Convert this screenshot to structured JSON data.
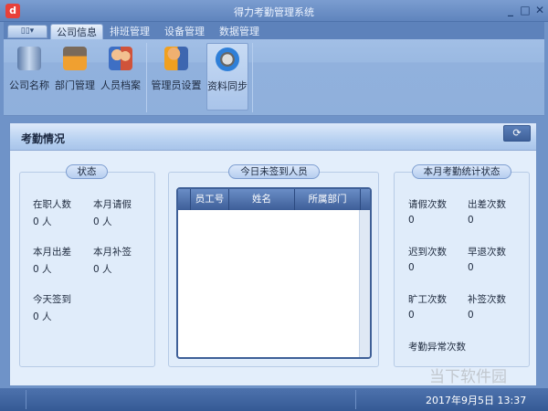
{
  "window": {
    "title": "得力考勤管理系统",
    "logo": "d",
    "controls": [
      "minimize-icon",
      "maximize-icon",
      "close-icon"
    ]
  },
  "tabs": [
    {
      "label": "公司信息",
      "active": true
    },
    {
      "label": "排班管理"
    },
    {
      "label": "设备管理"
    },
    {
      "label": "数据管理"
    }
  ],
  "ribbon": {
    "buttons": [
      {
        "label": "公司名称",
        "icon": "building-icon"
      },
      {
        "label": "部门管理",
        "icon": "house-icon"
      },
      {
        "label": "人员档案",
        "icon": "people-icon"
      },
      {
        "label": "管理员设置",
        "icon": "admin-icon"
      },
      {
        "label": "资料同步",
        "icon": "sync-icon",
        "selected": true
      }
    ]
  },
  "panel": {
    "title": "考勤情况",
    "refresh_glyph": "⟳"
  },
  "status": {
    "title": "状态",
    "items": [
      {
        "label": "在职人数",
        "value": "0 人"
      },
      {
        "label": "本月请假",
        "value": "0 人"
      },
      {
        "label": "本月出差",
        "value": "0 人"
      },
      {
        "label": "本月补签",
        "value": "0 人"
      },
      {
        "label": "今天签到",
        "value": "0 人"
      }
    ]
  },
  "absent": {
    "title": "今日未签到人员",
    "columns": [
      "员工号",
      "姓名",
      "所属部门"
    ],
    "rows": []
  },
  "monthly": {
    "title": "本月考勤统计状态",
    "items": [
      {
        "label": "请假次数",
        "value": "0"
      },
      {
        "label": "出差次数",
        "value": "0"
      },
      {
        "label": "迟到次数",
        "value": "0"
      },
      {
        "label": "早退次数",
        "value": "0"
      },
      {
        "label": "旷工次数",
        "value": "0"
      },
      {
        "label": "补签次数",
        "value": "0"
      },
      {
        "label": "考勤异常次数",
        "value": ""
      }
    ]
  },
  "statusbar": {
    "datetime": "2017年9月5日 13:37"
  },
  "watermark": "当下软件园",
  "colors": {
    "titlebar": "#5f84bd",
    "ribbon": "#9ab9e2",
    "panel": "#e3eefb",
    "header": "#3d5e98"
  }
}
